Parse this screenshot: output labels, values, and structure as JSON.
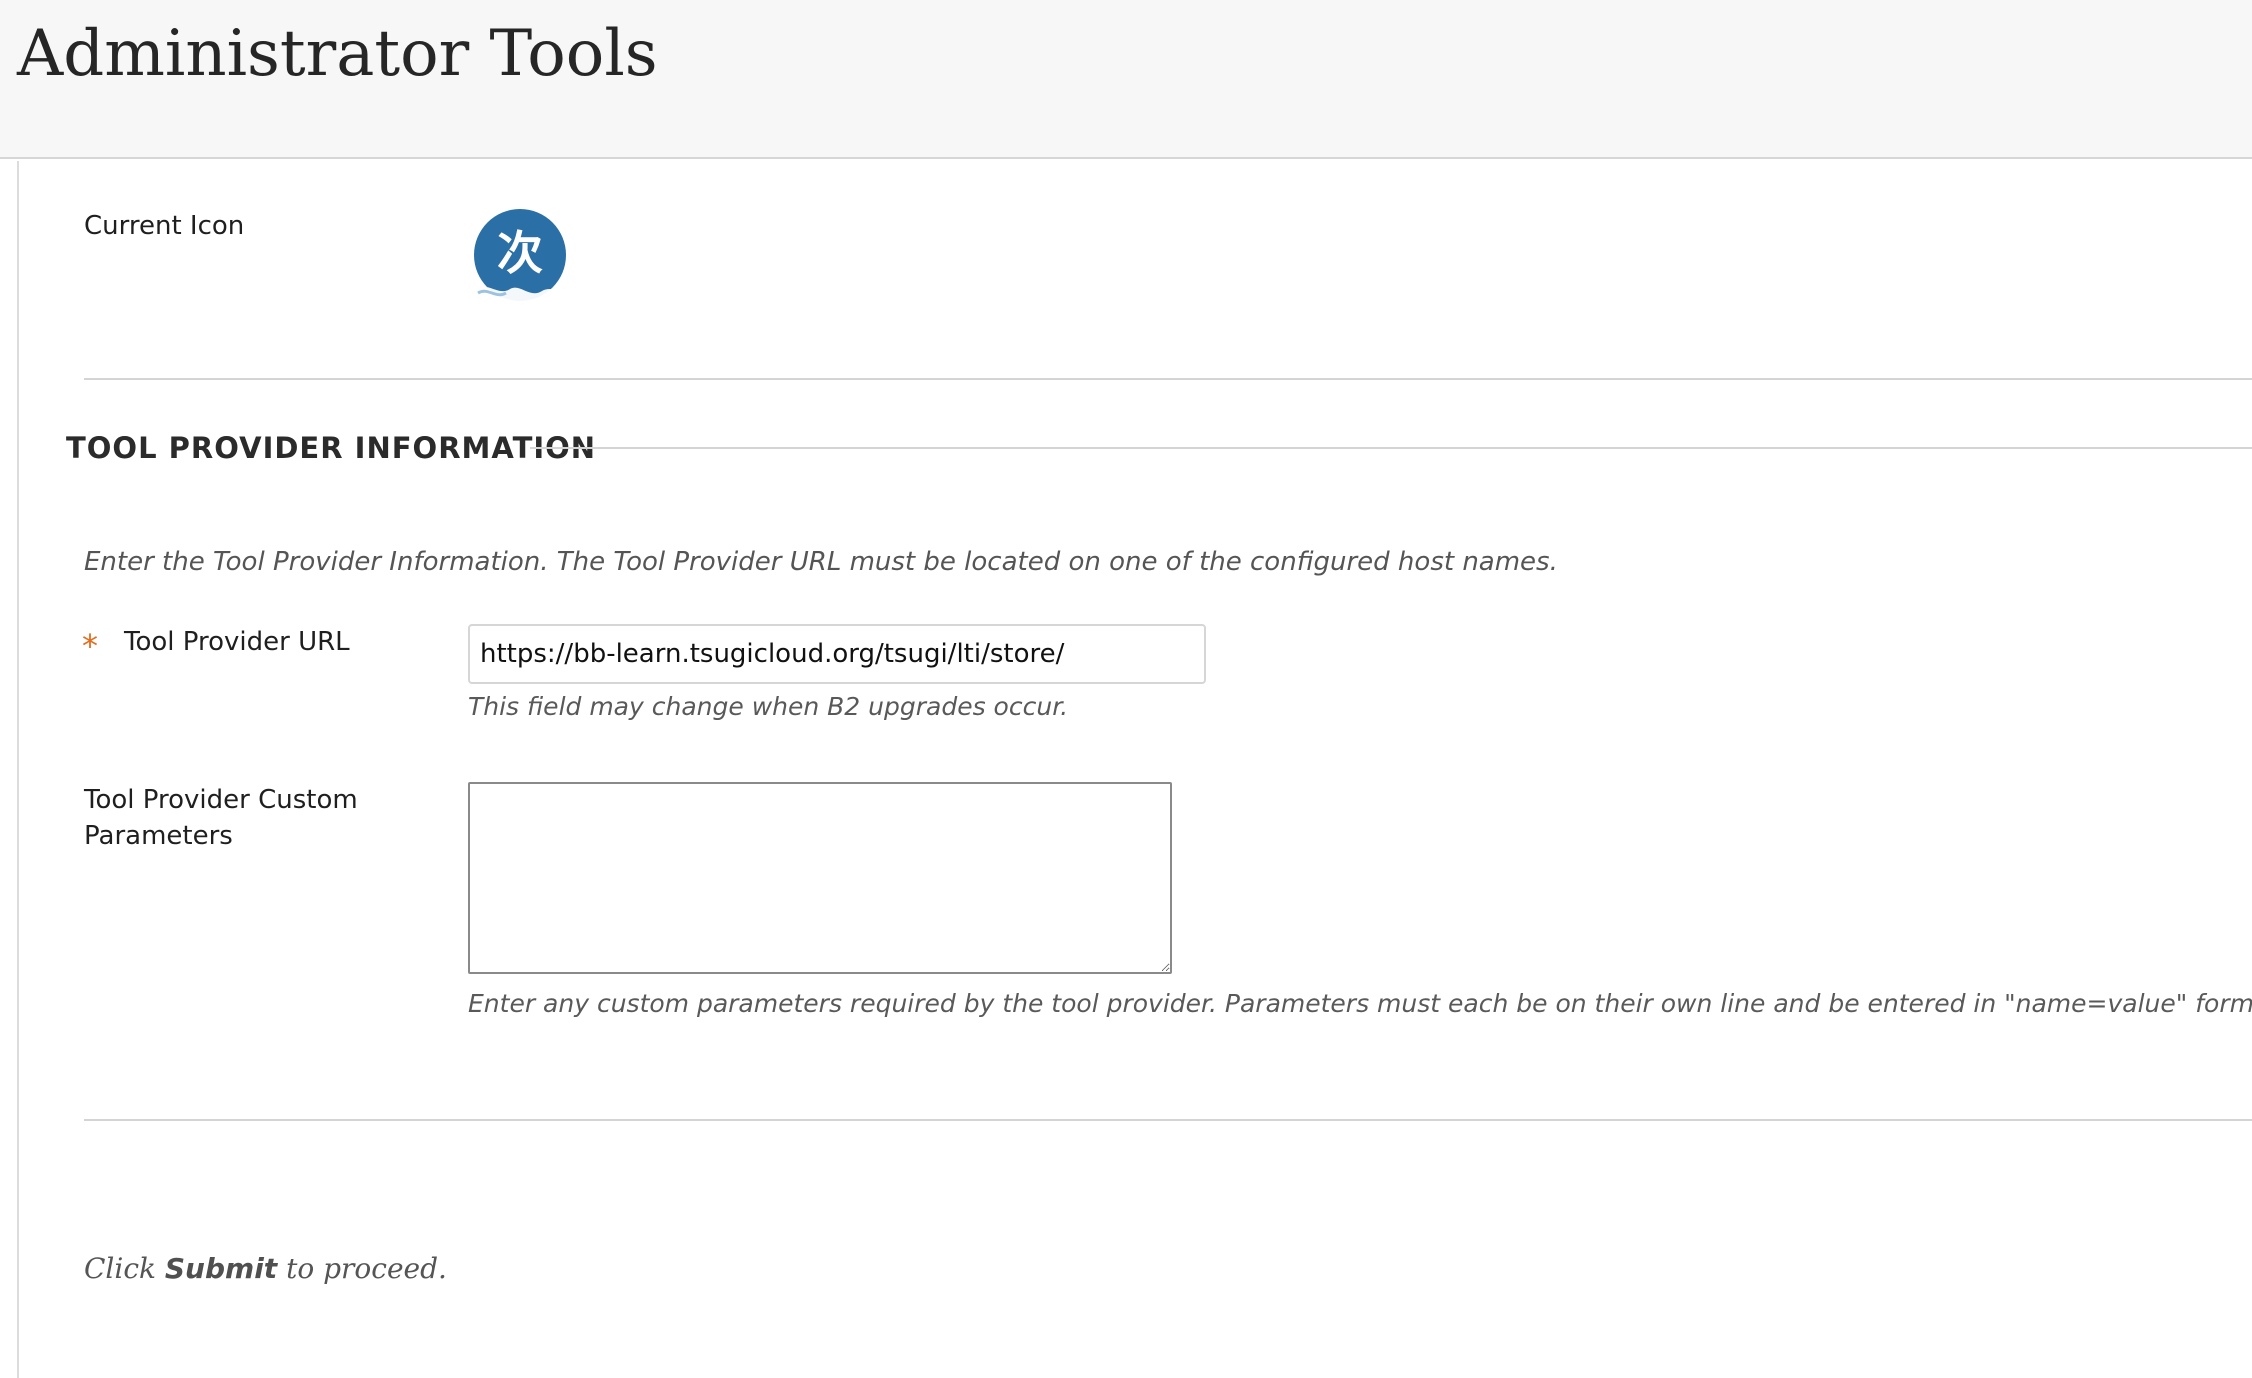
{
  "header": {
    "title": "Administrator Tools"
  },
  "icon_section": {
    "label": "Current Icon",
    "icon_name": "tool-provider-icon",
    "icon_glyph": "次",
    "icon_color": "#2a6fa5"
  },
  "tool_provider": {
    "section_title": "TOOL PROVIDER INFORMATION",
    "instructions": "Enter the Tool Provider Information. The Tool Provider URL must be located on one of the configured host names.",
    "url_required_marker": "*",
    "url_label": "Tool Provider URL",
    "url_value": "https://bb-learn.tsugicloud.org/tsugi/lti/store/",
    "url_hint": "This field may change when B2 upgrades occur.",
    "custom_params_label_line1": "Tool Provider Custom",
    "custom_params_label_line2": "Parameters",
    "custom_params_value": "",
    "custom_params_hint": "Enter any custom parameters required by the tool provider. Parameters must each be on their own line and be entered in \"name=value\" format."
  },
  "footer": {
    "submit_prefix": "Click",
    "submit_word": "Submit",
    "submit_suffix": "to proceed."
  },
  "colors": {
    "required_star": "#e46c1e",
    "header_background": "#f7f7f7",
    "icon_blue": "#2a6fa5"
  }
}
